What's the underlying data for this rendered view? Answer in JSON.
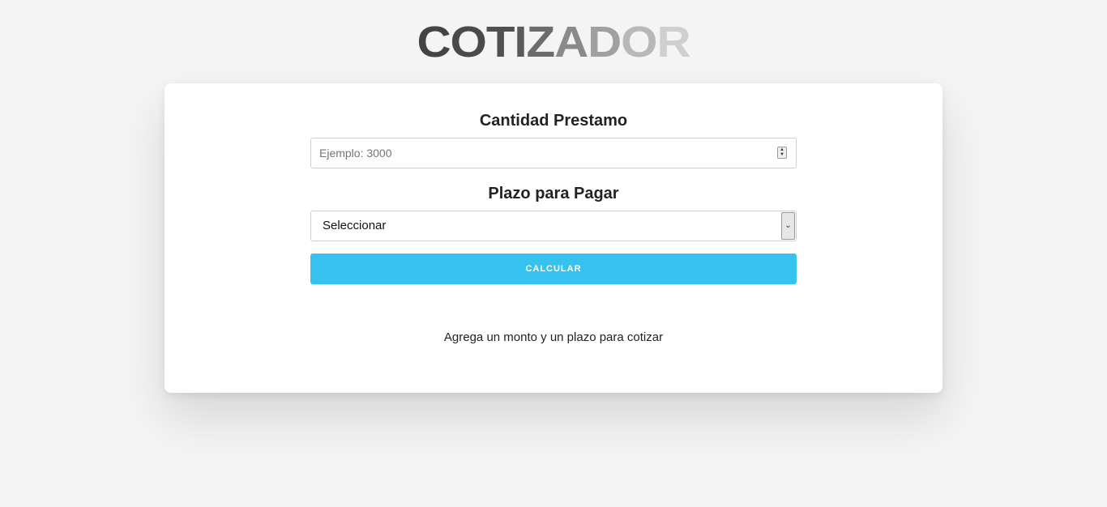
{
  "logo": {
    "letters": [
      {
        "char": "C",
        "color": "#444444"
      },
      {
        "char": "O",
        "color": "#4a4a4a"
      },
      {
        "char": "T",
        "color": "#505050"
      },
      {
        "char": "I",
        "color": "#5a5a5a"
      },
      {
        "char": "Z",
        "color": "#6c6c6c"
      },
      {
        "char": "A",
        "color": "#8a8a8a"
      },
      {
        "char": "D",
        "color": "#a0a0a0"
      },
      {
        "char": "O",
        "color": "#b8b8b8"
      },
      {
        "char": "R",
        "color": "#cfcfcf"
      }
    ]
  },
  "form": {
    "amount_label": "Cantidad Prestamo",
    "amount_placeholder": "Ejemplo: 3000",
    "term_label": "Plazo para Pagar",
    "term_selected": "Seleccionar",
    "submit_label": "CALCULAR"
  },
  "result": {
    "message": "Agrega un monto y un plazo para cotizar"
  },
  "colors": {
    "accent": "#35c2ee",
    "background": "#f4f4f4",
    "card": "#ffffff"
  },
  "icons": {
    "spinner": "number-spinner-icon",
    "select": "chevron-down-icon"
  }
}
